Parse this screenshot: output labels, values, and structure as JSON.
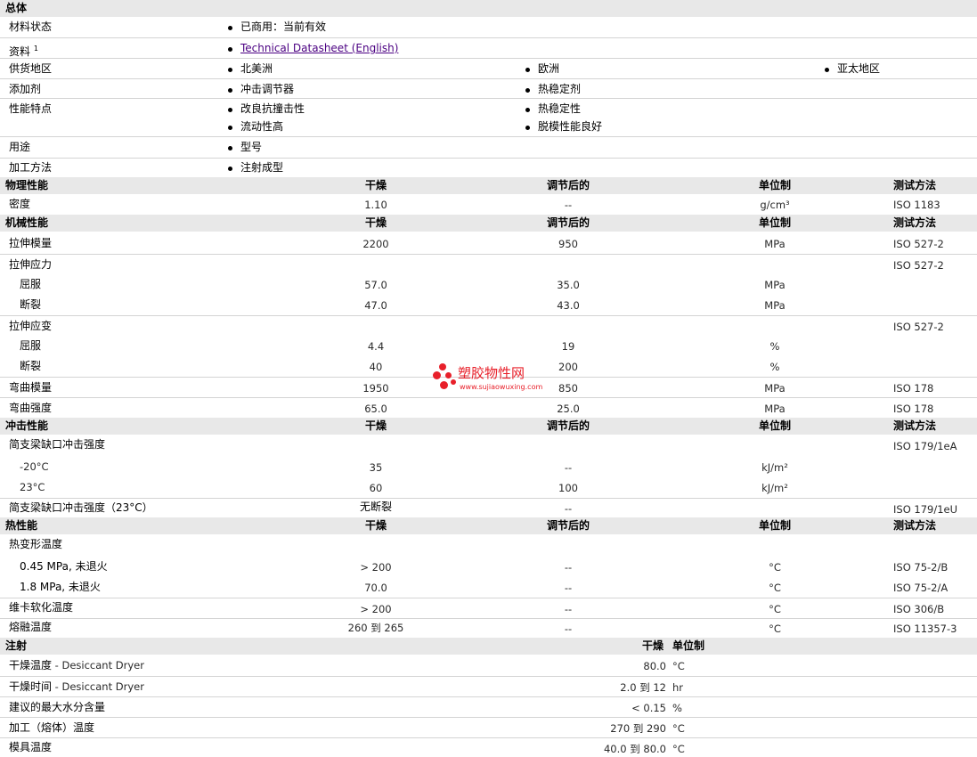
{
  "general": {
    "header": "总体",
    "material_status": {
      "label": "材料状态",
      "value": "已商用：当前有效"
    },
    "docs": {
      "label": "资料",
      "sup": "1",
      "link": "Technical Datasheet (English)"
    },
    "supply": {
      "label": "供货地区",
      "items": [
        "北美洲",
        "欧洲",
        "亚太地区"
      ]
    },
    "additives": {
      "label": "添加剂",
      "items": [
        "冲击调节器",
        "热稳定剂"
      ]
    },
    "features": {
      "label": "性能特点",
      "items": [
        "改良抗撞击性",
        "热稳定性",
        "流动性高",
        "脱模性能良好"
      ]
    },
    "uses": {
      "label": "用途",
      "items": [
        "型号"
      ]
    },
    "processing": {
      "label": "加工方法",
      "items": [
        "注射成型"
      ]
    }
  },
  "col_headers": {
    "dry": "干燥",
    "cond": "调节后的",
    "unit": "单位制",
    "method": "测试方法"
  },
  "physical": {
    "header": "物理性能",
    "rows": [
      {
        "name": "密度",
        "dry": "1.10",
        "cond": "--",
        "unit": "g/cm³",
        "method": "ISO 1183"
      }
    ]
  },
  "mechanical": {
    "header": "机械性能",
    "rows": [
      {
        "name": "拉伸模量",
        "dry": "2200",
        "cond": "950",
        "unit": "MPa",
        "method": "ISO 527-2"
      },
      {
        "name": "拉伸应力",
        "dry": "",
        "cond": "",
        "unit": "",
        "method": "ISO 527-2"
      },
      {
        "name": "屈服",
        "dry": "57.0",
        "cond": "35.0",
        "unit": "MPa",
        "method": ""
      },
      {
        "name": "断裂",
        "dry": "47.0",
        "cond": "43.0",
        "unit": "MPa",
        "method": ""
      },
      {
        "name": "拉伸应变",
        "dry": "",
        "cond": "",
        "unit": "",
        "method": "ISO 527-2"
      },
      {
        "name": "屈服",
        "dry": "4.4",
        "cond": "19",
        "unit": "%",
        "method": ""
      },
      {
        "name": "断裂",
        "dry": "40",
        "cond": "200",
        "unit": "%",
        "method": ""
      },
      {
        "name": "弯曲模量",
        "dry": "1950",
        "cond": "850",
        "unit": "MPa",
        "method": "ISO 178"
      },
      {
        "name": "弯曲强度",
        "dry": "65.0",
        "cond": "25.0",
        "unit": "MPa",
        "method": "ISO 178"
      }
    ]
  },
  "impact": {
    "header": "冲击性能",
    "rows": [
      {
        "name": "简支梁缺口冲击强度",
        "dry": "",
        "cond": "",
        "unit": "",
        "method": "ISO 179/1eA"
      },
      {
        "name": "-20°C",
        "dry": "35",
        "cond": "--",
        "unit": "kJ/m²",
        "method": ""
      },
      {
        "name": "23°C",
        "dry": "60",
        "cond": "100",
        "unit": "kJ/m²",
        "method": ""
      },
      {
        "name": "简支梁缺口冲击强度（23°C）",
        "dry": "无断裂",
        "cond": "--",
        "unit": "",
        "method": "ISO 179/1eU"
      }
    ]
  },
  "thermal": {
    "header": "热性能",
    "rows": [
      {
        "name": "热变形温度",
        "dry": "",
        "cond": "",
        "unit": "",
        "method": ""
      },
      {
        "name": "0.45 MPa, 未退火",
        "dry": "> 200",
        "cond": "--",
        "unit": "°C",
        "method": "ISO 75-2/B"
      },
      {
        "name": "1.8 MPa, 未退火",
        "dry": "70.0",
        "cond": "--",
        "unit": "°C",
        "method": "ISO 75-2/A"
      },
      {
        "name": "维卡软化温度",
        "dry": "> 200",
        "cond": "--",
        "unit": "°C",
        "method": "ISO 306/B"
      },
      {
        "name": "熔融温度",
        "dry": "260 到  265",
        "cond": "--",
        "unit": "°C",
        "method": "ISO 11357-3"
      }
    ]
  },
  "injection": {
    "header": "注射",
    "col_dry": "干燥",
    "col_unit": "单位制",
    "rows": [
      {
        "name": "干燥温度",
        "suffix": " - Desiccant Dryer",
        "value": "80.0",
        "unit": "°C"
      },
      {
        "name": "干燥时间",
        "suffix": " - Desiccant Dryer",
        "value": "2.0 到  12",
        "unit": "hr"
      },
      {
        "name": "建议的最大水分含量",
        "suffix": "",
        "value": "< 0.15",
        "unit": "%"
      },
      {
        "name": "加工（熔体）温度",
        "suffix": "",
        "value": "270 到  290",
        "unit": "°C"
      },
      {
        "name": "模具温度",
        "suffix": "",
        "value": "40.0 到  80.0",
        "unit": "°C"
      }
    ]
  },
  "watermark": {
    "title": "塑胶物性网",
    "url": "www.sujiaowuxing.com"
  }
}
